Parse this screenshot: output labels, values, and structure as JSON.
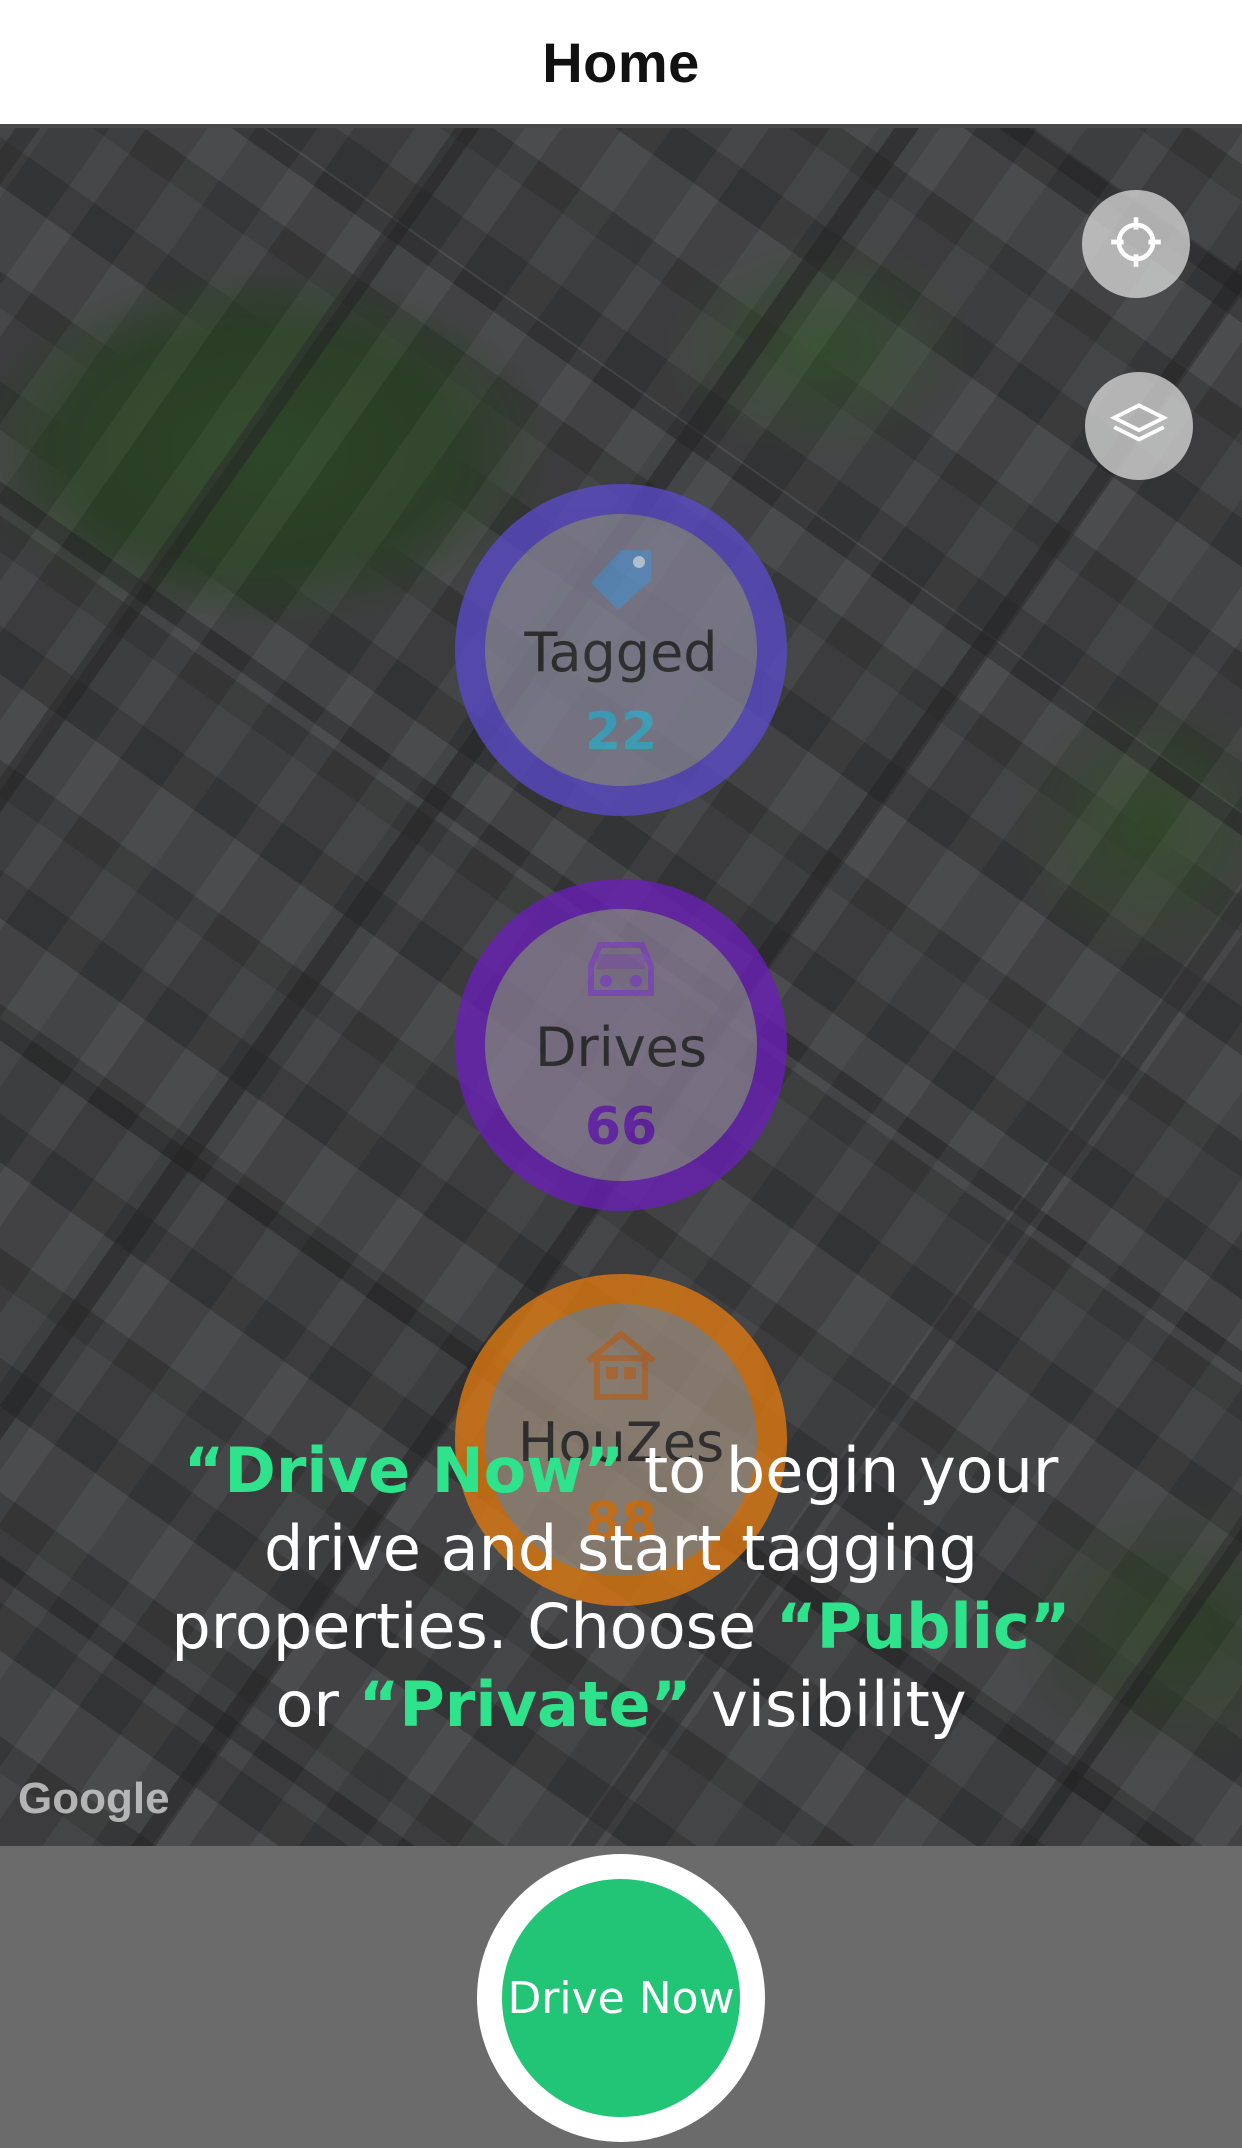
{
  "header": {
    "title": "Home"
  },
  "map": {
    "attribution": "Google",
    "controls": [
      {
        "name": "locate",
        "icon": "crosshair-icon"
      },
      {
        "name": "layers",
        "icon": "layers-icon"
      }
    ]
  },
  "stats": [
    {
      "label": "Tagged",
      "value": "22",
      "icon": "tag-icon",
      "ring_color": "#5a4ac8",
      "value_color": "#3fb6d6"
    },
    {
      "label": "Drives",
      "value": "66",
      "icon": "car-icon",
      "ring_color": "#6a1fb8",
      "value_color": "#6a1fb8"
    },
    {
      "label": "HouZes",
      "value": "88",
      "icon": "house-icon",
      "ring_color": "#e07a10",
      "value_color": "#e07a10"
    }
  ],
  "instruction": {
    "part1_highlight": "“Drive Now”",
    "part2": " to begin your drive and start tagging properties. Choose ",
    "part3_highlight": "“Public”",
    "part4": " or ",
    "part5_highlight": "“Private”",
    "part6": " visibility"
  },
  "drive_button": {
    "label": "Drive Now"
  },
  "colors": {
    "accent": "#22c576",
    "highlight": "#2ee38c"
  }
}
